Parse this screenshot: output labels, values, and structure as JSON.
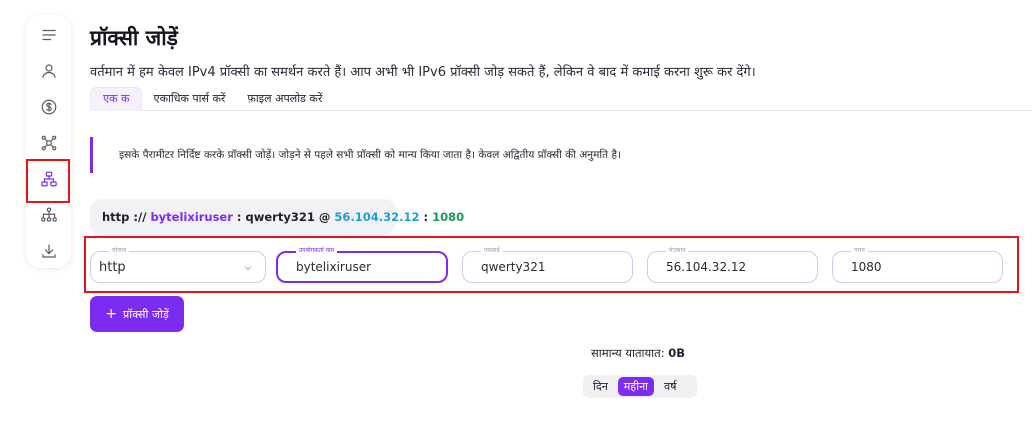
{
  "sidebar": {
    "items": [
      {
        "icon": "menu-icon"
      },
      {
        "icon": "user-icon"
      },
      {
        "icon": "dollar-icon"
      },
      {
        "icon": "network-icon"
      },
      {
        "icon": "hierarchy-icon",
        "active": true
      },
      {
        "icon": "share-tree-icon"
      },
      {
        "icon": "download-icon"
      }
    ],
    "accent_color": "#7b2cf0"
  },
  "header": {
    "title": "प्रॉक्सी जोड़ें",
    "description": "वर्तमान में हम केवल IPv4 प्रॉक्सी का समर्थन करते हैं। आप अभी भी IPv6 प्रॉक्सी जोड़ सकते हैं, लेकिन वे बाद में कमाई करना शुरू कर देंगे।"
  },
  "tabs": [
    {
      "label": "एक क",
      "active": true
    },
    {
      "label": "एकाधिक पार्स करें",
      "active": false
    },
    {
      "label": "फ़ाइल अपलोड करें",
      "active": false
    }
  ],
  "callout": {
    "text": "इसके पैरामीटर निर्दिष्ट करके प्रॉक्सी जोड़ें। जोड़ने से पहले सभी प्रॉक्सी को मान्य किया जाता है। केवल अद्वितीय प्रॉक्सी की अनुमति है।"
  },
  "preview": {
    "scheme": "http",
    "sep1": " :// ",
    "username": "bytelixiruser",
    "sep2": " : ",
    "password": "qwerty321",
    "sep3": " @ ",
    "host": "56.104.32.12",
    "sep4": " : ",
    "port": "1080"
  },
  "form": {
    "protocol": {
      "label": "योजना",
      "value": "http"
    },
    "username": {
      "label": "उपयोगकर्ता नाम",
      "value": "bytelixiruser"
    },
    "password": {
      "label": "पासवर्ड",
      "value": "qwerty321"
    },
    "host": {
      "label": "मेज़बान",
      "value": "56.104.32.12"
    },
    "port": {
      "label": "पत्तन",
      "value": "1080"
    }
  },
  "add_button": {
    "label": "प्रॉक्सी जोड़ें"
  },
  "traffic": {
    "label": "सामान्य यातायात:",
    "value": "0B"
  },
  "period": {
    "options": [
      {
        "label": "दिन",
        "active": false
      },
      {
        "label": "महीना",
        "active": true
      },
      {
        "label": "वर्ष",
        "active": false
      }
    ]
  }
}
